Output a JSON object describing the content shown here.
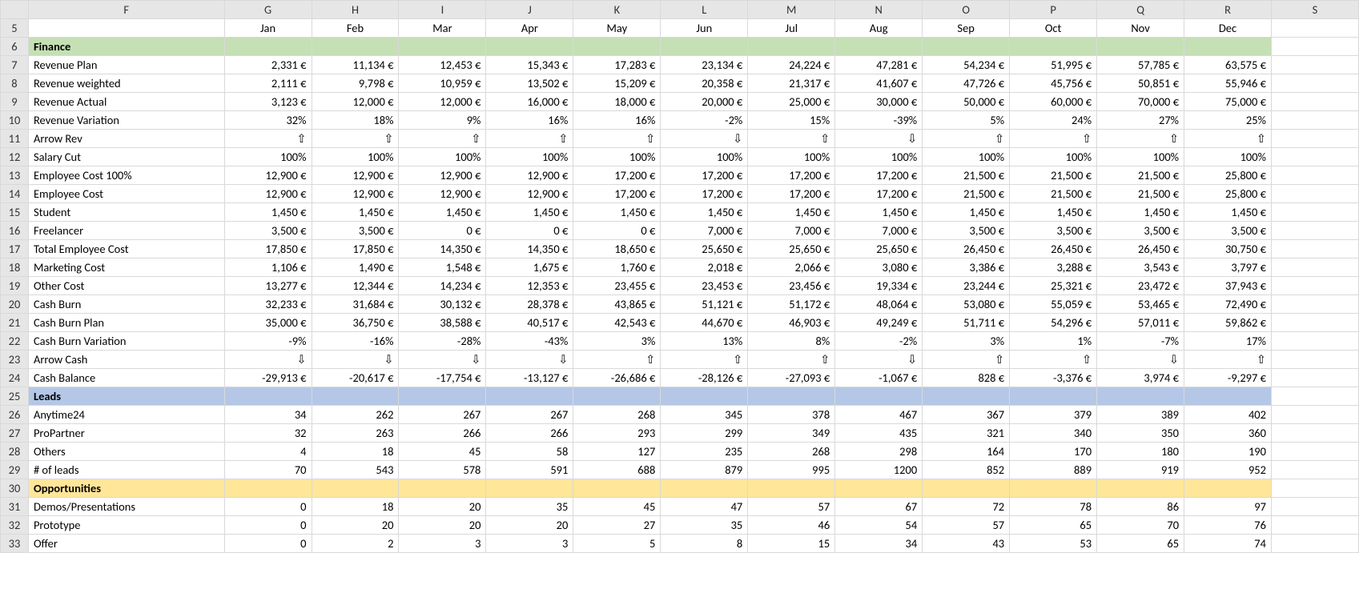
{
  "columns": [
    "F",
    "G",
    "H",
    "I",
    "J",
    "K",
    "L",
    "M",
    "N",
    "O",
    "P",
    "Q",
    "R",
    "S"
  ],
  "row_numbers": [
    5,
    6,
    7,
    8,
    9,
    10,
    11,
    12,
    13,
    14,
    15,
    16,
    17,
    18,
    19,
    20,
    21,
    22,
    23,
    24,
    25,
    26,
    27,
    28,
    29,
    30,
    31,
    32,
    33
  ],
  "months": [
    "Jan",
    "Feb",
    "Mar",
    "Apr",
    "May",
    "Jun",
    "Jul",
    "Aug",
    "Sep",
    "Oct",
    "Nov",
    "Dec"
  ],
  "sections": {
    "finance": {
      "label": "Finance"
    },
    "leads": {
      "label": "Leads"
    },
    "opps": {
      "label": "Opportunities"
    }
  },
  "rows": [
    {
      "id": "revenue-plan",
      "label": "Revenue Plan",
      "format": "euro",
      "v": [
        2331,
        11134,
        12453,
        15343,
        17283,
        23134,
        24224,
        47281,
        54234,
        51995,
        57785,
        63575
      ]
    },
    {
      "id": "revenue-weighted",
      "label": "Revenue weighted",
      "format": "euro",
      "v": [
        2111,
        9798,
        10959,
        13502,
        15209,
        20358,
        21317,
        41607,
        47726,
        45756,
        50851,
        55946
      ]
    },
    {
      "id": "revenue-actual",
      "label": "Revenue  Actual",
      "format": "euro",
      "v": [
        3123,
        12000,
        12000,
        16000,
        18000,
        20000,
        25000,
        30000,
        50000,
        60000,
        70000,
        75000
      ]
    },
    {
      "id": "revenue-variation",
      "label": "Revenue Variation",
      "format": "pct",
      "v": [
        32,
        18,
        9,
        16,
        16,
        -2,
        15,
        -39,
        5,
        24,
        27,
        25
      ]
    },
    {
      "id": "arrow-rev",
      "label": "Arrow Rev",
      "format": "arrow",
      "v": [
        "up",
        "up",
        "up",
        "up",
        "up",
        "down",
        "up",
        "down",
        "up",
        "up",
        "up",
        "up"
      ]
    },
    {
      "id": "salary-cut",
      "label": "Salary Cut",
      "format": "pct",
      "v": [
        100,
        100,
        100,
        100,
        100,
        100,
        100,
        100,
        100,
        100,
        100,
        100
      ]
    },
    {
      "id": "emp-cost-100",
      "label": "Employee Cost 100%",
      "format": "euro",
      "v": [
        12900,
        12900,
        12900,
        12900,
        17200,
        17200,
        17200,
        17200,
        21500,
        21500,
        21500,
        25800
      ]
    },
    {
      "id": "emp-cost",
      "label": "Employee Cost",
      "format": "euro",
      "v": [
        12900,
        12900,
        12900,
        12900,
        17200,
        17200,
        17200,
        17200,
        21500,
        21500,
        21500,
        25800
      ]
    },
    {
      "id": "student",
      "label": "Student",
      "format": "euro",
      "v": [
        1450,
        1450,
        1450,
        1450,
        1450,
        1450,
        1450,
        1450,
        1450,
        1450,
        1450,
        1450
      ]
    },
    {
      "id": "freelancer",
      "label": "Freelancer",
      "format": "euro",
      "v": [
        3500,
        3500,
        0,
        0,
        0,
        7000,
        7000,
        7000,
        3500,
        3500,
        3500,
        3500
      ]
    },
    {
      "id": "total-emp",
      "label": "Total Employee Cost",
      "format": "euro",
      "v": [
        17850,
        17850,
        14350,
        14350,
        18650,
        25650,
        25650,
        25650,
        26450,
        26450,
        26450,
        30750
      ]
    },
    {
      "id": "mkt-cost",
      "label": "Marketing Cost",
      "format": "euro",
      "v": [
        1106,
        1490,
        1548,
        1675,
        1760,
        2018,
        2066,
        3080,
        3386,
        3288,
        3543,
        3797
      ]
    },
    {
      "id": "other-cost",
      "label": "Other Cost",
      "format": "euro",
      "v": [
        13277,
        12344,
        14234,
        12353,
        23455,
        23453,
        23456,
        19334,
        23244,
        25321,
        23472,
        37943
      ]
    },
    {
      "id": "cash-burn",
      "label": "Cash Burn",
      "format": "euro",
      "v": [
        32233,
        31684,
        30132,
        28378,
        43865,
        51121,
        51172,
        48064,
        53080,
        55059,
        53465,
        72490
      ]
    },
    {
      "id": "cash-burn-plan",
      "label": "Cash Burn Plan",
      "format": "euro",
      "v": [
        35000,
        36750,
        38588,
        40517,
        42543,
        44670,
        46903,
        49249,
        51711,
        54296,
        57011,
        59862
      ]
    },
    {
      "id": "cash-burn-var",
      "label": "Cash Burn Variation",
      "format": "pct",
      "v": [
        -9,
        -16,
        -28,
        -43,
        3,
        13,
        8,
        -2,
        3,
        1,
        -7,
        17
      ]
    },
    {
      "id": "arrow-cash",
      "label": "Arrow Cash",
      "format": "arrow",
      "v": [
        "down",
        "down",
        "down",
        "down",
        "up",
        "up",
        "up",
        "down",
        "up",
        "up",
        "down",
        "up"
      ]
    },
    {
      "id": "cash-balance",
      "label": "Cash Balance",
      "format": "euro",
      "v": [
        -29913,
        -20617,
        -17754,
        -13127,
        -26686,
        -28126,
        -27093,
        -1067,
        828,
        -3376,
        3974,
        -9297
      ]
    },
    {
      "id": "anytime24",
      "label": "Anytime24",
      "format": "int",
      "v": [
        34,
        262,
        267,
        267,
        268,
        345,
        378,
        467,
        367,
        379,
        389,
        402
      ]
    },
    {
      "id": "propartner",
      "label": "ProPartner",
      "format": "int",
      "v": [
        32,
        263,
        266,
        266,
        293,
        299,
        349,
        435,
        321,
        340,
        350,
        360
      ]
    },
    {
      "id": "others",
      "label": "Others",
      "format": "int",
      "v": [
        4,
        18,
        45,
        58,
        127,
        235,
        268,
        298,
        164,
        170,
        180,
        190
      ]
    },
    {
      "id": "leads-count",
      "label": "# of leads",
      "format": "int",
      "v": [
        70,
        543,
        578,
        591,
        688,
        879,
        995,
        1200,
        852,
        889,
        919,
        952
      ]
    },
    {
      "id": "demos",
      "label": "Demos/Presentations",
      "format": "int",
      "v": [
        0,
        18,
        20,
        35,
        45,
        47,
        57,
        67,
        72,
        78,
        86,
        97
      ]
    },
    {
      "id": "prototype",
      "label": "Prototype",
      "format": "int",
      "v": [
        0,
        20,
        20,
        20,
        27,
        35,
        46,
        54,
        57,
        65,
        70,
        76
      ]
    },
    {
      "id": "offer",
      "label": "Offer",
      "format": "int",
      "v": [
        0,
        2,
        3,
        3,
        5,
        8,
        15,
        34,
        43,
        53,
        65,
        74
      ]
    }
  ],
  "chart_data": {
    "type": "table",
    "title": "",
    "categories": [
      "Jan",
      "Feb",
      "Mar",
      "Apr",
      "May",
      "Jun",
      "Jul",
      "Aug",
      "Sep",
      "Oct",
      "Nov",
      "Dec"
    ],
    "series": [
      {
        "name": "Revenue Plan",
        "unit": "EUR",
        "values": [
          2331,
          11134,
          12453,
          15343,
          17283,
          23134,
          24224,
          47281,
          54234,
          51995,
          57785,
          63575
        ]
      },
      {
        "name": "Revenue weighted",
        "unit": "EUR",
        "values": [
          2111,
          9798,
          10959,
          13502,
          15209,
          20358,
          21317,
          41607,
          47726,
          45756,
          50851,
          55946
        ]
      },
      {
        "name": "Revenue Actual",
        "unit": "EUR",
        "values": [
          3123,
          12000,
          12000,
          16000,
          18000,
          20000,
          25000,
          30000,
          50000,
          60000,
          70000,
          75000
        ]
      },
      {
        "name": "Revenue Variation",
        "unit": "%",
        "values": [
          32,
          18,
          9,
          16,
          16,
          -2,
          15,
          -39,
          5,
          24,
          27,
          25
        ]
      },
      {
        "name": "Salary Cut",
        "unit": "%",
        "values": [
          100,
          100,
          100,
          100,
          100,
          100,
          100,
          100,
          100,
          100,
          100,
          100
        ]
      },
      {
        "name": "Employee Cost 100%",
        "unit": "EUR",
        "values": [
          12900,
          12900,
          12900,
          12900,
          17200,
          17200,
          17200,
          17200,
          21500,
          21500,
          21500,
          25800
        ]
      },
      {
        "name": "Employee Cost",
        "unit": "EUR",
        "values": [
          12900,
          12900,
          12900,
          12900,
          17200,
          17200,
          17200,
          17200,
          21500,
          21500,
          21500,
          25800
        ]
      },
      {
        "name": "Student",
        "unit": "EUR",
        "values": [
          1450,
          1450,
          1450,
          1450,
          1450,
          1450,
          1450,
          1450,
          1450,
          1450,
          1450,
          1450
        ]
      },
      {
        "name": "Freelancer",
        "unit": "EUR",
        "values": [
          3500,
          3500,
          0,
          0,
          0,
          7000,
          7000,
          7000,
          3500,
          3500,
          3500,
          3500
        ]
      },
      {
        "name": "Total Employee Cost",
        "unit": "EUR",
        "values": [
          17850,
          17850,
          14350,
          14350,
          18650,
          25650,
          25650,
          25650,
          26450,
          26450,
          26450,
          30750
        ]
      },
      {
        "name": "Marketing Cost",
        "unit": "EUR",
        "values": [
          1106,
          1490,
          1548,
          1675,
          1760,
          2018,
          2066,
          3080,
          3386,
          3288,
          3543,
          3797
        ]
      },
      {
        "name": "Other Cost",
        "unit": "EUR",
        "values": [
          13277,
          12344,
          14234,
          12353,
          23455,
          23453,
          23456,
          19334,
          23244,
          25321,
          23472,
          37943
        ]
      },
      {
        "name": "Cash Burn",
        "unit": "EUR",
        "values": [
          32233,
          31684,
          30132,
          28378,
          43865,
          51121,
          51172,
          48064,
          53080,
          55059,
          53465,
          72490
        ]
      },
      {
        "name": "Cash Burn Plan",
        "unit": "EUR",
        "values": [
          35000,
          36750,
          38588,
          40517,
          42543,
          44670,
          46903,
          49249,
          51711,
          54296,
          57011,
          59862
        ]
      },
      {
        "name": "Cash Burn Variation",
        "unit": "%",
        "values": [
          -9,
          -16,
          -28,
          -43,
          3,
          13,
          8,
          -2,
          3,
          1,
          -7,
          17
        ]
      },
      {
        "name": "Cash Balance",
        "unit": "EUR",
        "values": [
          -29913,
          -20617,
          -17754,
          -13127,
          -26686,
          -28126,
          -27093,
          -1067,
          828,
          -3376,
          3974,
          -9297
        ]
      },
      {
        "name": "Anytime24",
        "unit": "",
        "values": [
          34,
          262,
          267,
          267,
          268,
          345,
          378,
          467,
          367,
          379,
          389,
          402
        ]
      },
      {
        "name": "ProPartner",
        "unit": "",
        "values": [
          32,
          263,
          266,
          266,
          293,
          299,
          349,
          435,
          321,
          340,
          350,
          360
        ]
      },
      {
        "name": "Others",
        "unit": "",
        "values": [
          4,
          18,
          45,
          58,
          127,
          235,
          268,
          298,
          164,
          170,
          180,
          190
        ]
      },
      {
        "name": "# of leads",
        "unit": "",
        "values": [
          70,
          543,
          578,
          591,
          688,
          879,
          995,
          1200,
          852,
          889,
          919,
          952
        ]
      },
      {
        "name": "Demos/Presentations",
        "unit": "",
        "values": [
          0,
          18,
          20,
          35,
          45,
          47,
          57,
          67,
          72,
          78,
          86,
          97
        ]
      },
      {
        "name": "Prototype",
        "unit": "",
        "values": [
          0,
          20,
          20,
          20,
          27,
          35,
          46,
          54,
          57,
          65,
          70,
          76
        ]
      },
      {
        "name": "Offer",
        "unit": "",
        "values": [
          0,
          2,
          3,
          3,
          5,
          8,
          15,
          34,
          43,
          53,
          65,
          74
        ]
      }
    ]
  }
}
